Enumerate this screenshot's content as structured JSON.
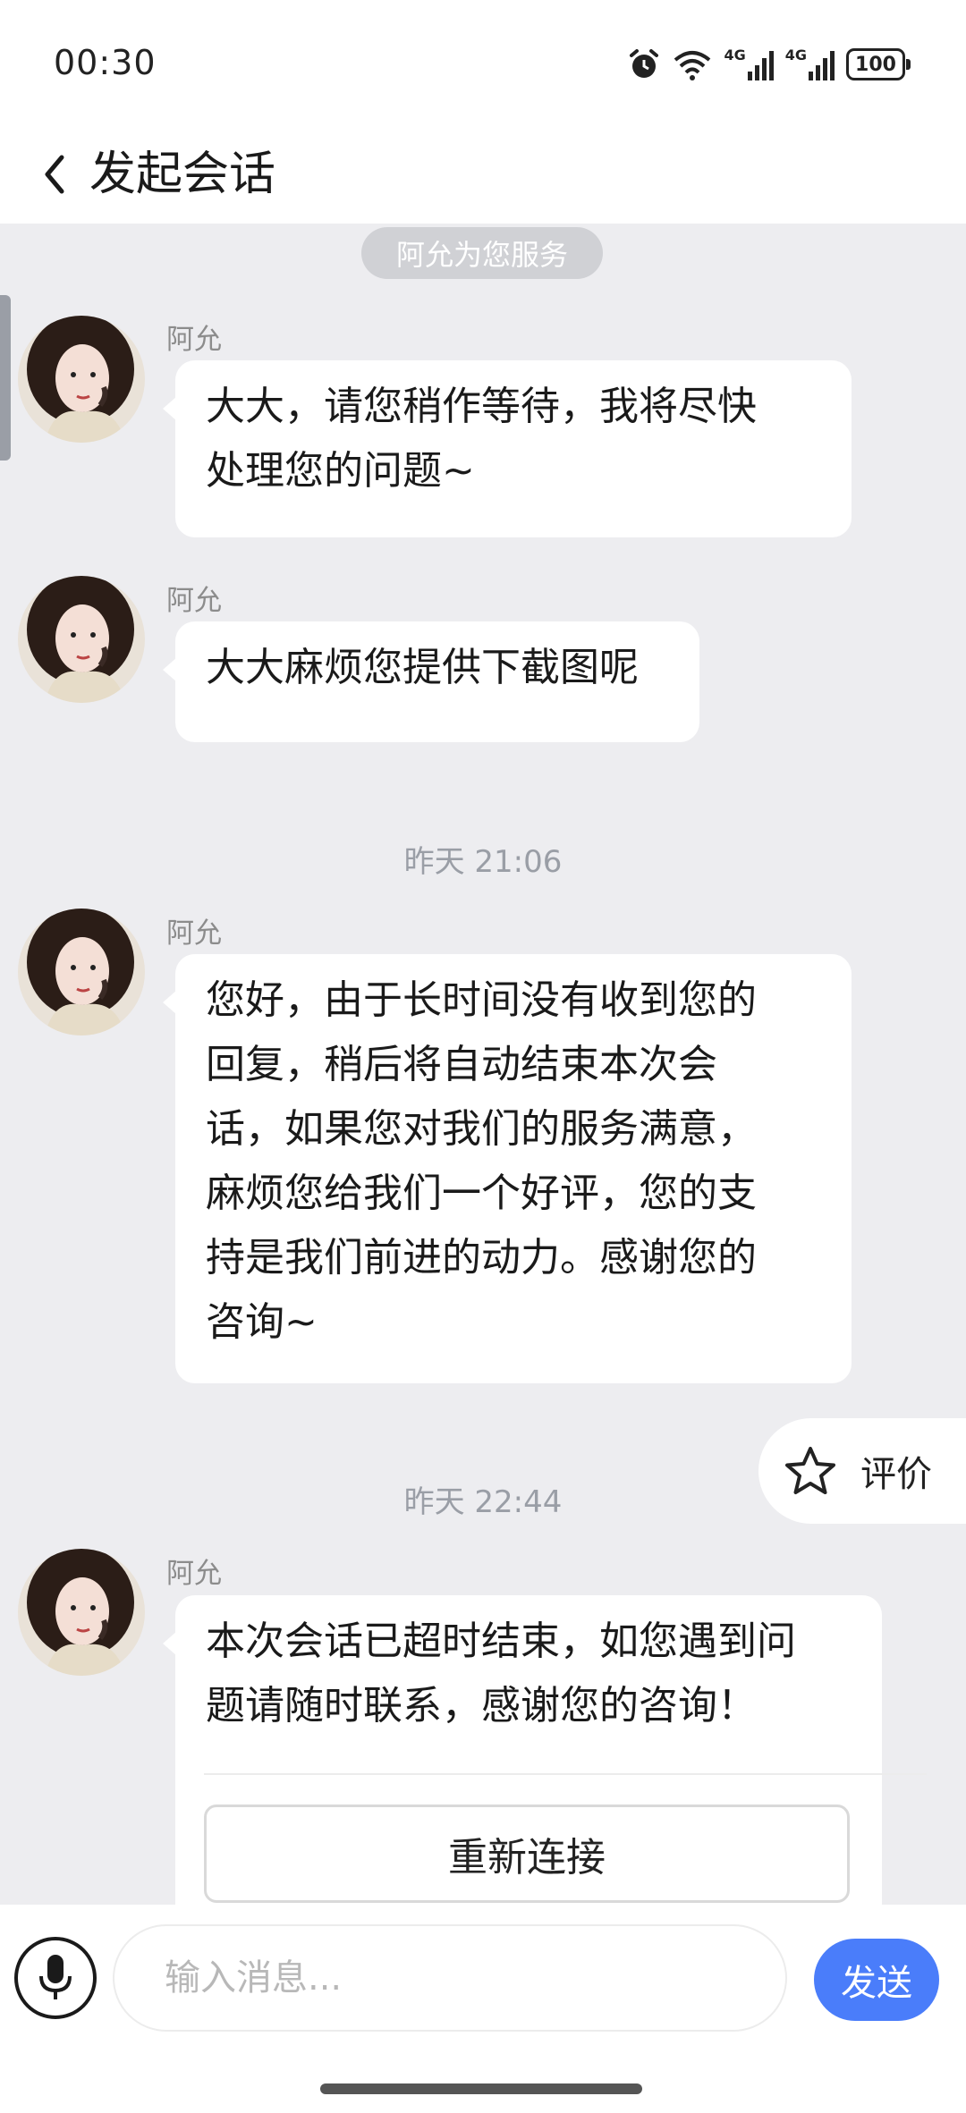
{
  "status_bar": {
    "time": "00:30",
    "network1": "4G",
    "network2": "4G",
    "battery": "100",
    "icons": [
      "alarm-icon",
      "wifi-icon",
      "signal-icon",
      "signal-icon",
      "battery-icon"
    ]
  },
  "header": {
    "title": "发起会话",
    "back_icon": "chevron-left-icon"
  },
  "chat": {
    "service_notice": "阿允为您服务",
    "messages": [
      {
        "sender": "阿允",
        "lines": [
          "大大，请您稍作等待，我将尽快",
          "处理您的问题~"
        ]
      },
      {
        "sender": "阿允",
        "lines": [
          "大大麻烦您提供下截图呢"
        ]
      }
    ],
    "timestamp1": "昨天 21:06",
    "message3": {
      "sender": "阿允",
      "lines": [
        "您好，由于长时间没有收到您的",
        "回复，稍后将自动结束本次会",
        "话，如果您对我们的服务满意，",
        "麻烦您给我们一个好评，您的支",
        "持是我们前进的动力。感谢您的",
        "咨询~"
      ]
    },
    "rate_button": {
      "label": "评价",
      "icon": "star-icon"
    },
    "timestamp2": "昨天 22:44",
    "message4": {
      "sender": "阿允",
      "lines": [
        "本次会话已超时结束，如您遇到问",
        "题请随时联系，感谢您的咨询！"
      ],
      "reconnect_label": "重新连接"
    }
  },
  "input_bar": {
    "mic_icon": "microphone-icon",
    "placeholder": "输入消息...",
    "send_label": "发送"
  },
  "colors": {
    "accent": "#4a7dfa",
    "chat_background": "#ededf0",
    "bubble": "#ffffff",
    "timestamp": "#9a9ea6"
  }
}
